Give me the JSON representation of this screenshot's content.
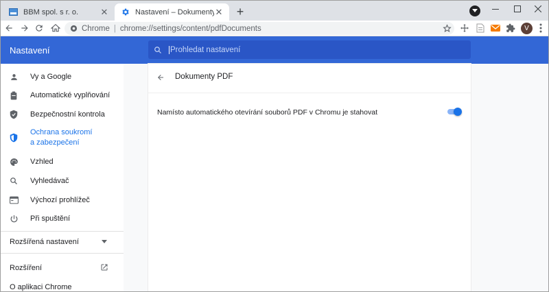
{
  "tabs": [
    {
      "title": "BBM spol. s r. o.",
      "active": false
    },
    {
      "title": "Nastavení – Dokumenty PDF",
      "active": true
    }
  ],
  "toolbar": {
    "origin": "Chrome",
    "url": "chrome://settings/content/pdfDocuments",
    "avatar_letter": "V"
  },
  "settings": {
    "title": "Nastavení",
    "search_placeholder": "Prohledat nastavení"
  },
  "sidebar": {
    "items": [
      {
        "label": "Vy a Google",
        "icon": "person-icon"
      },
      {
        "label": "Automatické vyplňování",
        "icon": "clipboard-icon"
      },
      {
        "label": "Bezpečnostní kontrola",
        "icon": "shield-check-icon"
      },
      {
        "label": "Ochrana soukromí",
        "label2": "a zabezpečení",
        "icon": "shield-icon",
        "active": true
      },
      {
        "label": "Vzhled",
        "icon": "palette-icon"
      },
      {
        "label": "Vyhledávač",
        "icon": "search-icon"
      },
      {
        "label": "Výchozí prohlížeč",
        "icon": "browser-icon"
      },
      {
        "label": "Při spuštění",
        "icon": "power-icon"
      }
    ],
    "advanced": "Rozšířená nastavení",
    "extensions": "Rozšíření",
    "about": "O aplikaci Chrome"
  },
  "page": {
    "title": "Dokumenty PDF",
    "setting_label": "Namísto automatického otevírání souborů PDF v Chromu je stahovat",
    "toggle_on": true
  },
  "colors": {
    "header": "#3367d6",
    "search": "#2a56c6",
    "accent": "#1a73e8"
  }
}
